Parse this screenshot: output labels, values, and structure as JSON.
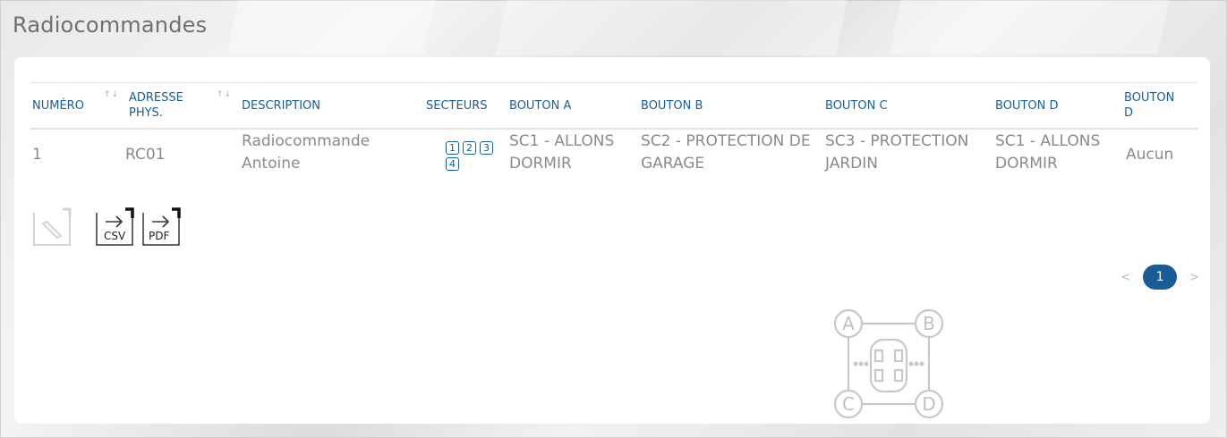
{
  "page": {
    "title": "Radiocommandes"
  },
  "table": {
    "columns": [
      {
        "label": "NUMÉRO",
        "sortable": true
      },
      {
        "label": "ADRESSE PHYS.",
        "sortable": true
      },
      {
        "label": "DESCRIPTION",
        "sortable": false
      },
      {
        "label": "SECTEURS",
        "sortable": false
      },
      {
        "label": "BOUTON A",
        "sortable": false
      },
      {
        "label": "BOUTON B",
        "sortable": false
      },
      {
        "label": "BOUTON C",
        "sortable": false
      },
      {
        "label": "BOUTON D",
        "sortable": false
      },
      {
        "label": "BOUTON D",
        "sortable": false
      }
    ],
    "sort_icon": "↑↓",
    "rows": [
      {
        "numero": "1",
        "adresse": "RC01",
        "description": "Radiocommande Antoine",
        "secteurs": [
          "1",
          "2",
          "3",
          "4"
        ],
        "bouton_a": "SC1 - ALLONS DORMIR",
        "bouton_b": "SC2 - PROTECTION DE GARAGE",
        "bouton_c": "SC3 - PROTECTION JARDIN",
        "bouton_d": "SC1 - ALLONS DORMIR",
        "bouton_d2": "Aucun"
      }
    ]
  },
  "actions": {
    "edit_icon": "edit-icon",
    "export_csv_label": "CSV",
    "export_pdf_label": "PDF"
  },
  "pagination": {
    "prev": "<",
    "current": "1",
    "next": ">"
  },
  "remote_diagram": {
    "labels": [
      "A",
      "B",
      "C",
      "D"
    ]
  },
  "colors": {
    "accent": "#1a5d96",
    "text_muted": "#8a8a8a",
    "title": "#6f6f6f"
  }
}
